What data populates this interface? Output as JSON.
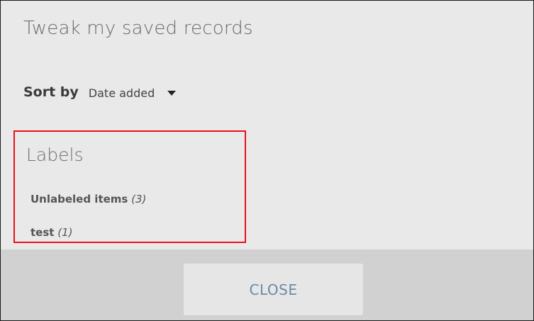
{
  "dialog": {
    "title": "Tweak my saved records"
  },
  "sort": {
    "label": "Sort by",
    "selected": "Date added"
  },
  "labels": {
    "heading": "Labels",
    "items": [
      {
        "name": "Unlabeled items",
        "count": "(3)"
      },
      {
        "name": "test",
        "count": "(1)"
      }
    ]
  },
  "footer": {
    "close_label": "CLOSE"
  },
  "colors": {
    "highlight_border": "#e8101c",
    "close_text": "#6b8aa8",
    "footer_bg": "#d1d1d1",
    "dialog_bg": "#e9e9e9"
  }
}
